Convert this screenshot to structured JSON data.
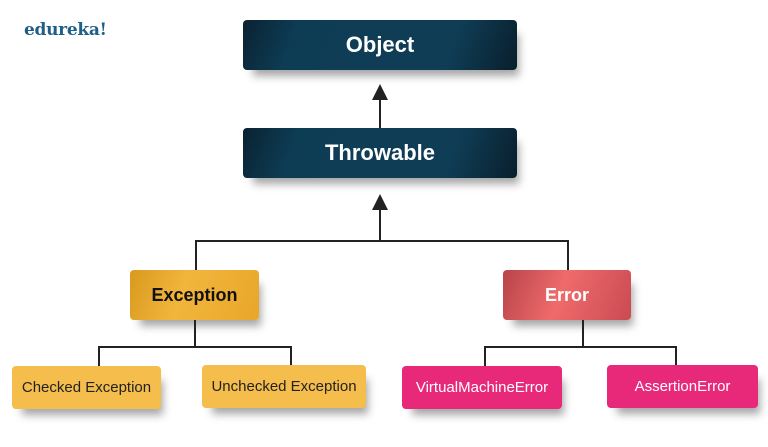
{
  "logo": "edureka!",
  "nodes": {
    "object": "Object",
    "throwable": "Throwable",
    "exception": "Exception",
    "error": "Error",
    "checked": "Checked Exception",
    "unchecked": "Unchecked Exception",
    "vme": "VirtualMachineError",
    "assertion": "AssertionError"
  },
  "colors": {
    "dark": "#0f3d55",
    "exception": "#f2b53c",
    "error": "#ef6b6b",
    "leaf_yellow": "#f4bd4c",
    "leaf_pink": "#e8297a"
  }
}
